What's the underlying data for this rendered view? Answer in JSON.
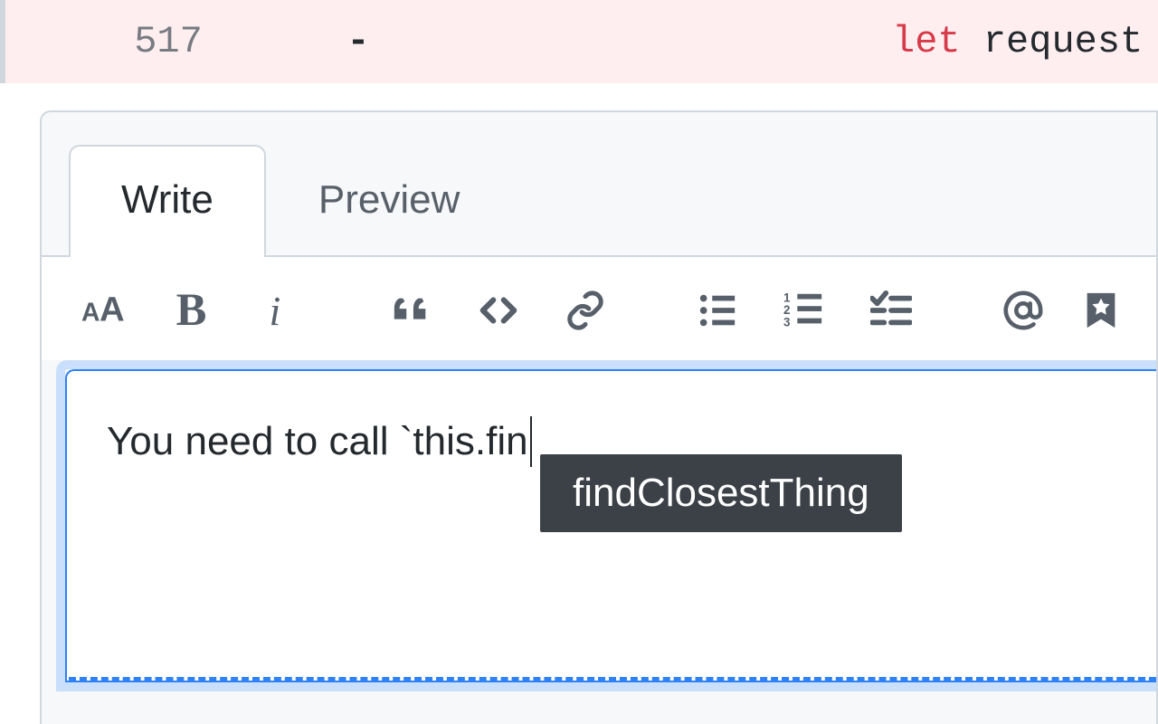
{
  "diff": {
    "line_number": "517",
    "marker": "-",
    "code_keyword": "let",
    "code_rest": " request"
  },
  "tabs": {
    "write": "Write",
    "preview": "Preview"
  },
  "toolbar_icons": {
    "heading": "heading-icon",
    "bold": "bold-icon",
    "italic": "italic-icon",
    "quote": "quote-icon",
    "code": "code-icon",
    "link": "link-icon",
    "ul": "unordered-list-icon",
    "ol": "ordered-list-icon",
    "task": "task-list-icon",
    "mention": "mention-icon",
    "saved": "saved-reply-icon"
  },
  "completion": {
    "suggestion": "findClosestThing"
  },
  "editor": {
    "content": "You need to call `this.fin"
  }
}
